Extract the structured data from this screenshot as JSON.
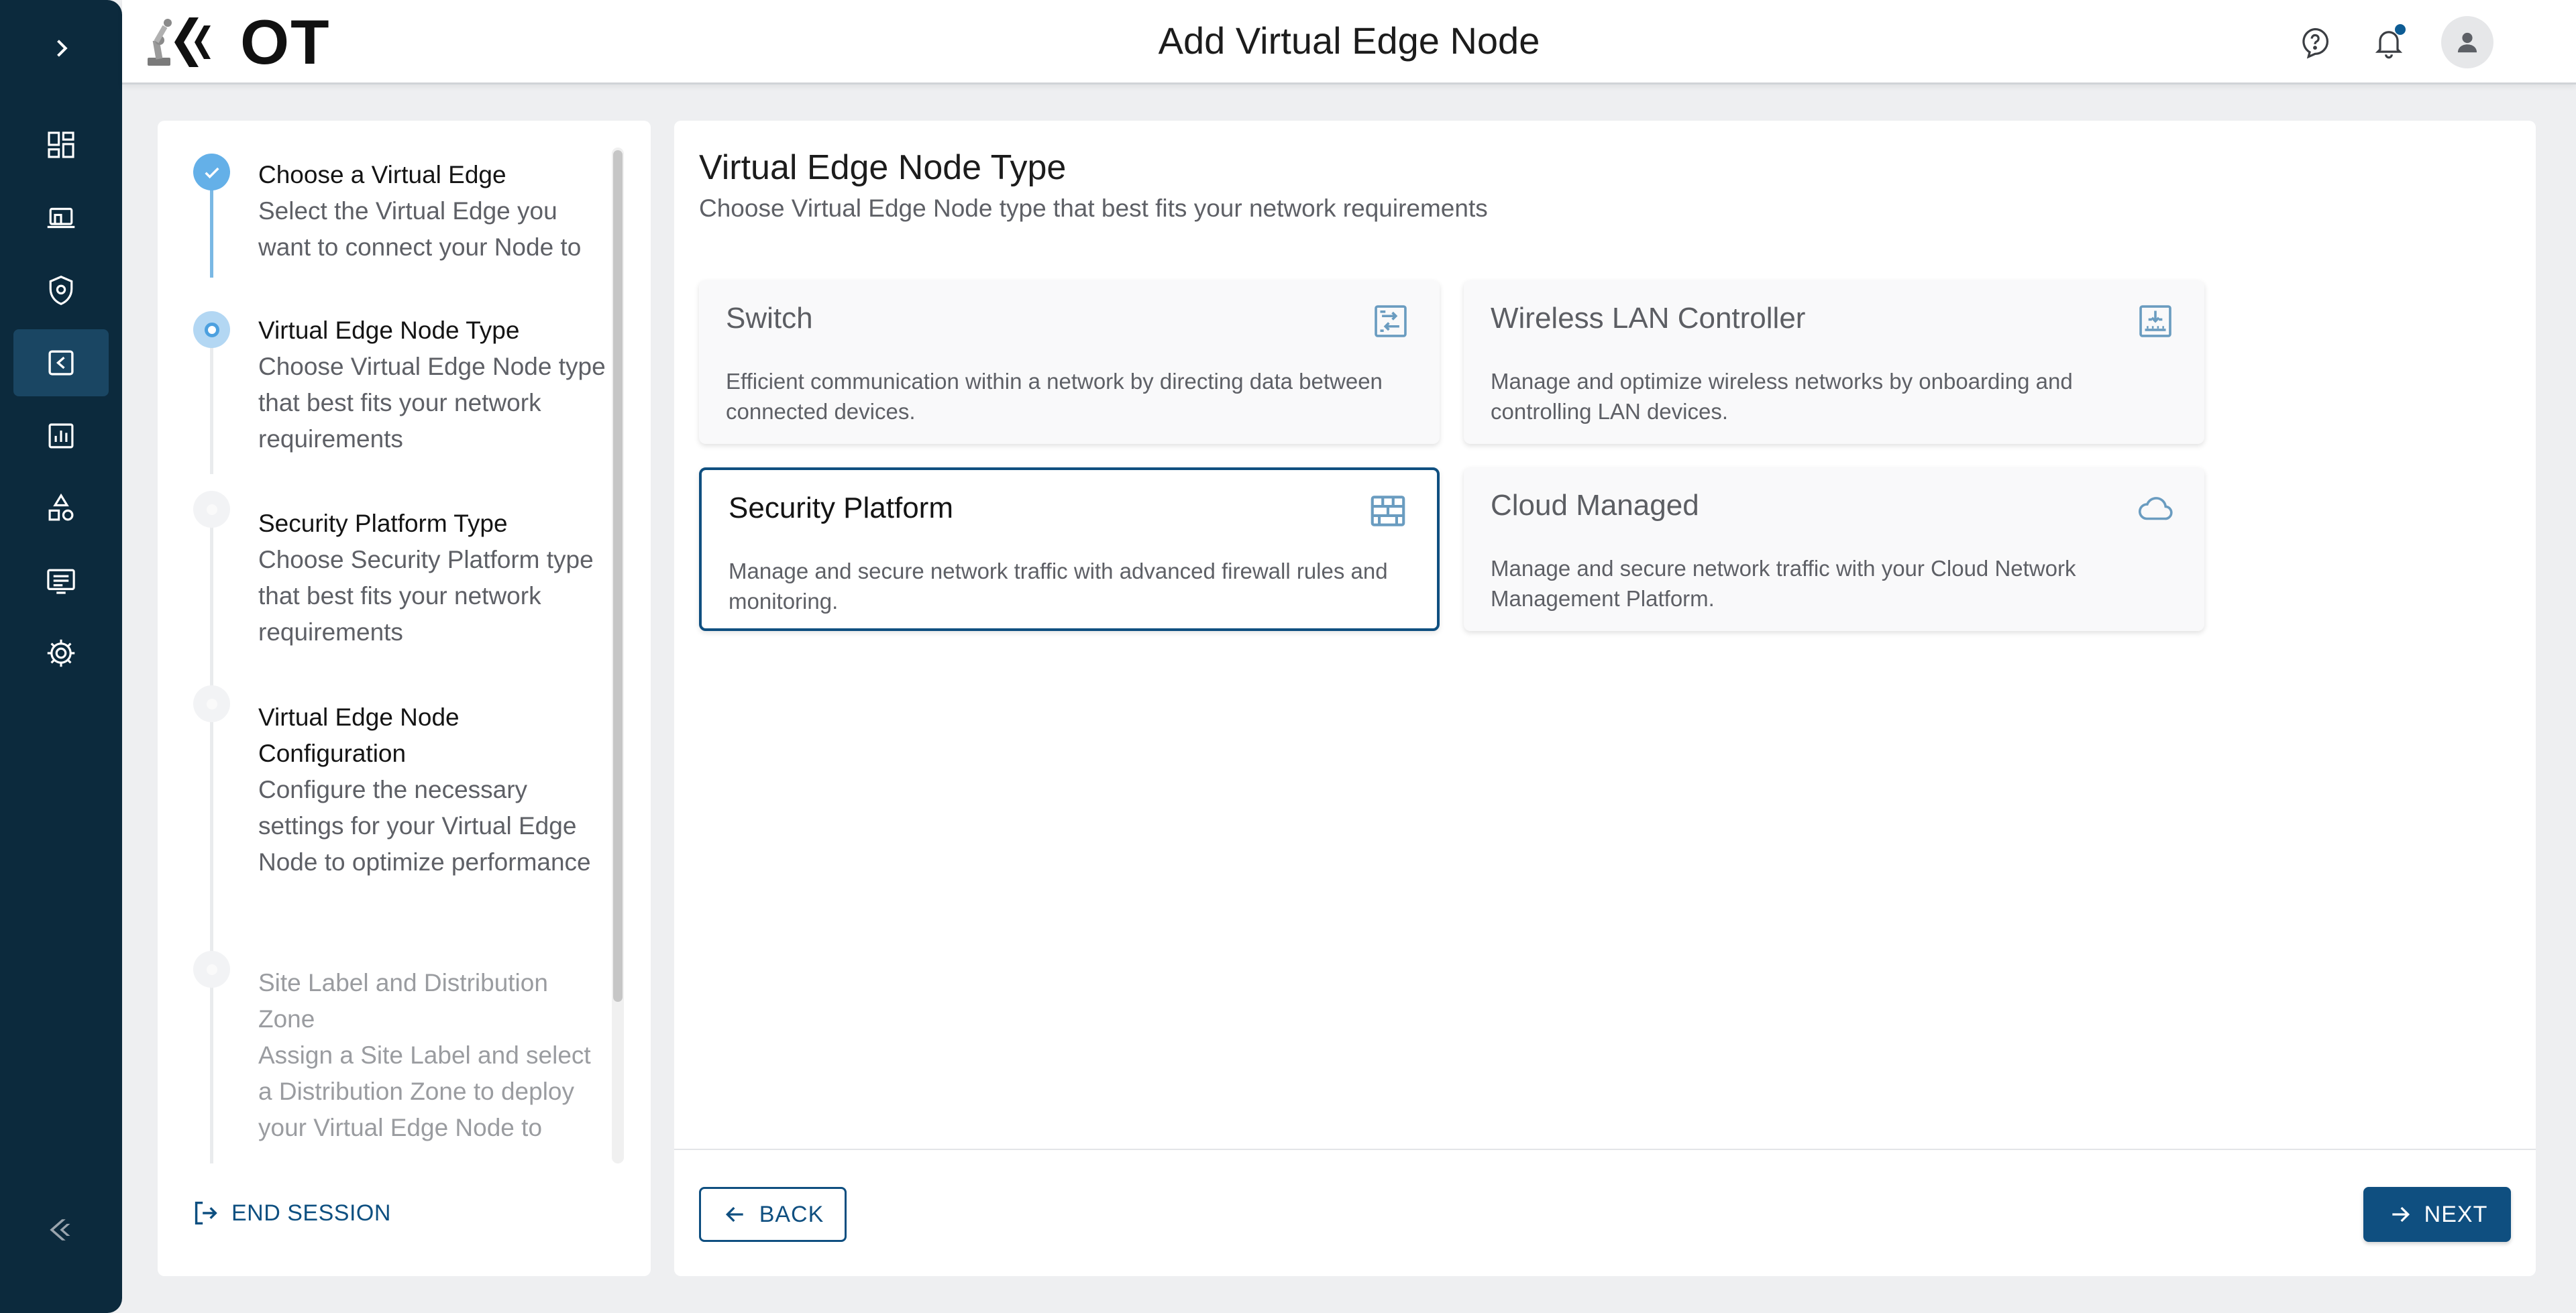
{
  "header": {
    "logo_text": "OT",
    "title": "Add Virtual Edge Node"
  },
  "nav": {
    "expand_icon": "chevron-right-icon",
    "items": [
      {
        "icon": "dashboard-icon",
        "active": false
      },
      {
        "icon": "devices-icon",
        "active": false
      },
      {
        "icon": "security-shield-icon",
        "active": false
      },
      {
        "icon": "virtual-edge-icon",
        "active": true
      },
      {
        "icon": "reports-chart-icon",
        "active": false
      },
      {
        "icon": "shapes-icon",
        "active": false
      },
      {
        "icon": "list-window-icon",
        "active": false
      },
      {
        "icon": "settings-gear-icon",
        "active": false
      }
    ],
    "bottom_icon": "brand-logo-icon"
  },
  "steps": [
    {
      "title": "Choose a Virtual Edge",
      "desc": "Select the Virtual Edge you want to connect your Node to",
      "state": "done"
    },
    {
      "title": "Virtual Edge Node Type",
      "desc": "Choose Virtual Edge Node type that best fits your network requirements",
      "state": "current"
    },
    {
      "title": "Security Platform Type",
      "desc": "Choose Security Platform type that best fits your network requirements",
      "state": "pending"
    },
    {
      "title": "Virtual Edge Node Configuration",
      "desc": "Configure the necessary settings for your Virtual Edge Node to optimize performance",
      "state": "pending"
    },
    {
      "title": "Site Label and Distribution Zone",
      "desc": "Assign a Site Label and select a Distribution Zone to deploy your Virtual Edge Node to",
      "state": "disabled"
    }
  ],
  "end_session_label": "END SESSION",
  "main": {
    "title": "Virtual Edge Node Type",
    "subtitle": "Choose Virtual Edge Node type that best fits your network requirements",
    "cards": [
      {
        "title": "Switch",
        "desc": "Efficient communication within a network by directing data between connected devices.",
        "icon": "switch-icon",
        "selected": false
      },
      {
        "title": "Wireless LAN Controller",
        "desc": "Manage and optimize wireless networks by onboarding and controlling LAN devices.",
        "icon": "wlan-controller-icon",
        "selected": false
      },
      {
        "title": "Security Platform",
        "desc": "Manage and secure network traffic with advanced firewall rules and monitoring.",
        "icon": "firewall-icon",
        "selected": true
      },
      {
        "title": "Cloud Managed",
        "desc": "Manage and secure network traffic with your Cloud Network Management Platform.",
        "icon": "cloud-icon",
        "selected": false
      }
    ]
  },
  "footer": {
    "back_label": "BACK",
    "next_label": "NEXT"
  },
  "colors": {
    "nav_bg": "#0c2a3d",
    "accent": "#0f4f80",
    "step_done": "#64b0e8"
  }
}
